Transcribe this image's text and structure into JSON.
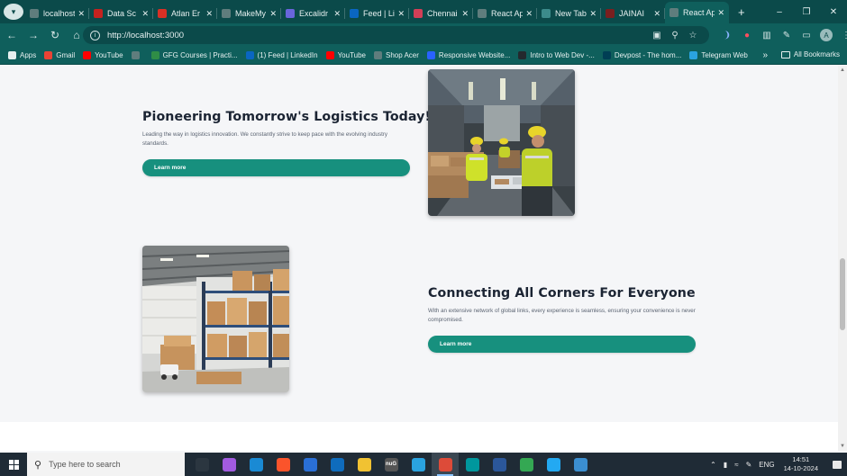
{
  "browser": {
    "tabs": [
      {
        "label": "localhost",
        "icon": "globe-icon",
        "color": "#5f7d7d"
      },
      {
        "label": "Data Sc",
        "icon": "gmail-icon",
        "color": "#c5221f"
      },
      {
        "label": "Atlan Er",
        "icon": "atlan-icon",
        "color": "#d93025"
      },
      {
        "label": "MakeMy",
        "icon": "globe-icon",
        "color": "#5f7d7d"
      },
      {
        "label": "Excalidr",
        "icon": "excalidraw-icon",
        "color": "#6965db"
      },
      {
        "label": "Feed | Li",
        "icon": "linkedin-icon",
        "color": "#0a66c2"
      },
      {
        "label": "Chennai",
        "icon": "bus-icon",
        "color": "#d23f57"
      },
      {
        "label": "React Ap",
        "icon": "globe-icon",
        "color": "#5f7d7d"
      },
      {
        "label": "New Tab",
        "icon": "chrome-icon",
        "color": "#3c8b8b"
      },
      {
        "label": "JAINAI",
        "icon": "jain-icon",
        "color": "#7a1f1f"
      },
      {
        "label": "React Ap",
        "icon": "globe-icon",
        "color": "#5f7d7d",
        "active": true
      }
    ],
    "new_tab": "+",
    "url": "http://localhost:3000",
    "bookmarks": [
      {
        "label": "Apps",
        "icon": "apps-grid-icon",
        "color": "#e6f0f0"
      },
      {
        "label": "Gmail",
        "icon": "gmail-icon",
        "color": "#ea4335"
      },
      {
        "label": "YouTube",
        "icon": "youtube-icon",
        "color": "#ff0000"
      },
      {
        "label": "",
        "icon": "globe-icon",
        "color": "#5f7d7d"
      },
      {
        "label": "GFG Courses | Practi...",
        "icon": "gfg-icon",
        "color": "#2f8d46"
      },
      {
        "label": "(1) Feed | LinkedIn",
        "icon": "linkedin-icon",
        "color": "#0a66c2"
      },
      {
        "label": "YouTube",
        "icon": "youtube-icon",
        "color": "#ff0000"
      },
      {
        "label": "Shop Acer",
        "icon": "globe-icon",
        "color": "#5f7d7d"
      },
      {
        "label": "Responsive Website...",
        "icon": "c-icon",
        "color": "#2962ff"
      },
      {
        "label": "Intro to Web Dev -...",
        "icon": "github-icon",
        "color": "#24292e"
      },
      {
        "label": "Devpost - The hom...",
        "icon": "devpost-icon",
        "color": "#003e54"
      },
      {
        "label": "Telegram Web",
        "icon": "telegram-icon",
        "color": "#2aa3e0"
      }
    ],
    "bookmarks_more": "»",
    "all_bookmarks": "All Bookmarks",
    "avatar_letter": "A"
  },
  "sections": [
    {
      "heading": "Pioneering Tomorrow's Logistics Today!",
      "description": "Leading the way in logistics innovation. We constantly strive to keep pace with the evolving industry standards.",
      "button": "Learn more",
      "image": "warehouse-workers-photo"
    },
    {
      "heading": "Connecting All Corners For Everyone",
      "description": "With an extensive network of global links, every experience is seamless, ensuring your convenience is never compromised.",
      "button": "Learn more",
      "image": "warehouse-shelves-photo"
    }
  ],
  "accent_color": "#17907e",
  "taskbar": {
    "search_placeholder": "Type here to search",
    "apps": [
      {
        "icon": "task-view-icon",
        "color": "#2b3640"
      },
      {
        "icon": "copilot-icon",
        "color": "#a25be0"
      },
      {
        "icon": "edge-icon",
        "color": "#1a8ad4"
      },
      {
        "icon": "brave-icon",
        "color": "#fb542b"
      },
      {
        "icon": "store-icon",
        "color": "#2a6fd6"
      },
      {
        "icon": "outlook-icon",
        "color": "#0f6cbd"
      },
      {
        "icon": "file-explorer-icon",
        "color": "#f1c232"
      },
      {
        "icon": "nug-icon",
        "color": "#555555",
        "text": "nuG"
      },
      {
        "icon": "telegram-icon",
        "color": "#2aa3e0"
      },
      {
        "icon": "chrome-icon",
        "color": "#dd4b39",
        "active": true
      },
      {
        "icon": "arduino-icon",
        "color": "#00979d"
      },
      {
        "icon": "word-icon",
        "color": "#2b579a"
      },
      {
        "icon": "drive-icon",
        "color": "#34a853"
      },
      {
        "icon": "vscode-icon",
        "color": "#23a9f2"
      },
      {
        "icon": "paint-icon",
        "color": "#3b8ed0"
      }
    ],
    "language": "ENG",
    "time": "14:51",
    "date": "14-10-2024"
  }
}
